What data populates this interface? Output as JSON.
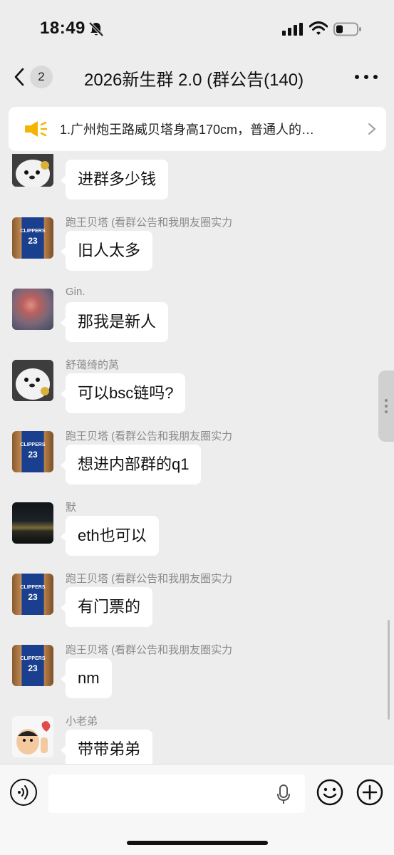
{
  "status_bar": {
    "time": "18:49"
  },
  "nav": {
    "unread_count": "2",
    "title": "2026新生群 2.0 (群公告(140)"
  },
  "announcement": {
    "text": "1.广州炮王路威贝塔身高170cm，普通人的…"
  },
  "messages": [
    {
      "sender": "",
      "text": "进群多少钱",
      "avatar": "bear-avatar"
    },
    {
      "sender": "跑王贝塔 (看群公告和我朋友圈实力",
      "text": "旧人太多",
      "avatar": "jersey-avatar"
    },
    {
      "sender": "Gin.",
      "text": "那我是新人",
      "avatar": "cloud-avatar"
    },
    {
      "sender": "舒蔼绮的莴",
      "text": "可以bsc链吗?",
      "avatar": "bear-avatar"
    },
    {
      "sender": "跑王贝塔 (看群公告和我朋友圈实力",
      "text": "想进内部群的q1",
      "avatar": "jersey-avatar"
    },
    {
      "sender": "默",
      "text": "eth也可以",
      "avatar": "dusk-avatar"
    },
    {
      "sender": "跑王贝塔 (看群公告和我朋友圈实力",
      "text": "有门票的",
      "avatar": "jersey-avatar"
    },
    {
      "sender": "跑王贝塔 (看群公告和我朋友圈实力",
      "text": "nm",
      "avatar": "jersey-avatar"
    },
    {
      "sender": "小老弟",
      "text": "带带弟弟",
      "avatar": "cartoon-avatar"
    }
  ],
  "jersey_text": {
    "team": "CLIPPERS",
    "number": "23"
  },
  "input": {
    "value": ""
  },
  "colors": {
    "background": "#ededed",
    "bubble": "#ffffff",
    "speaker": "#f4b400",
    "jersey": "#1b3f8f"
  }
}
